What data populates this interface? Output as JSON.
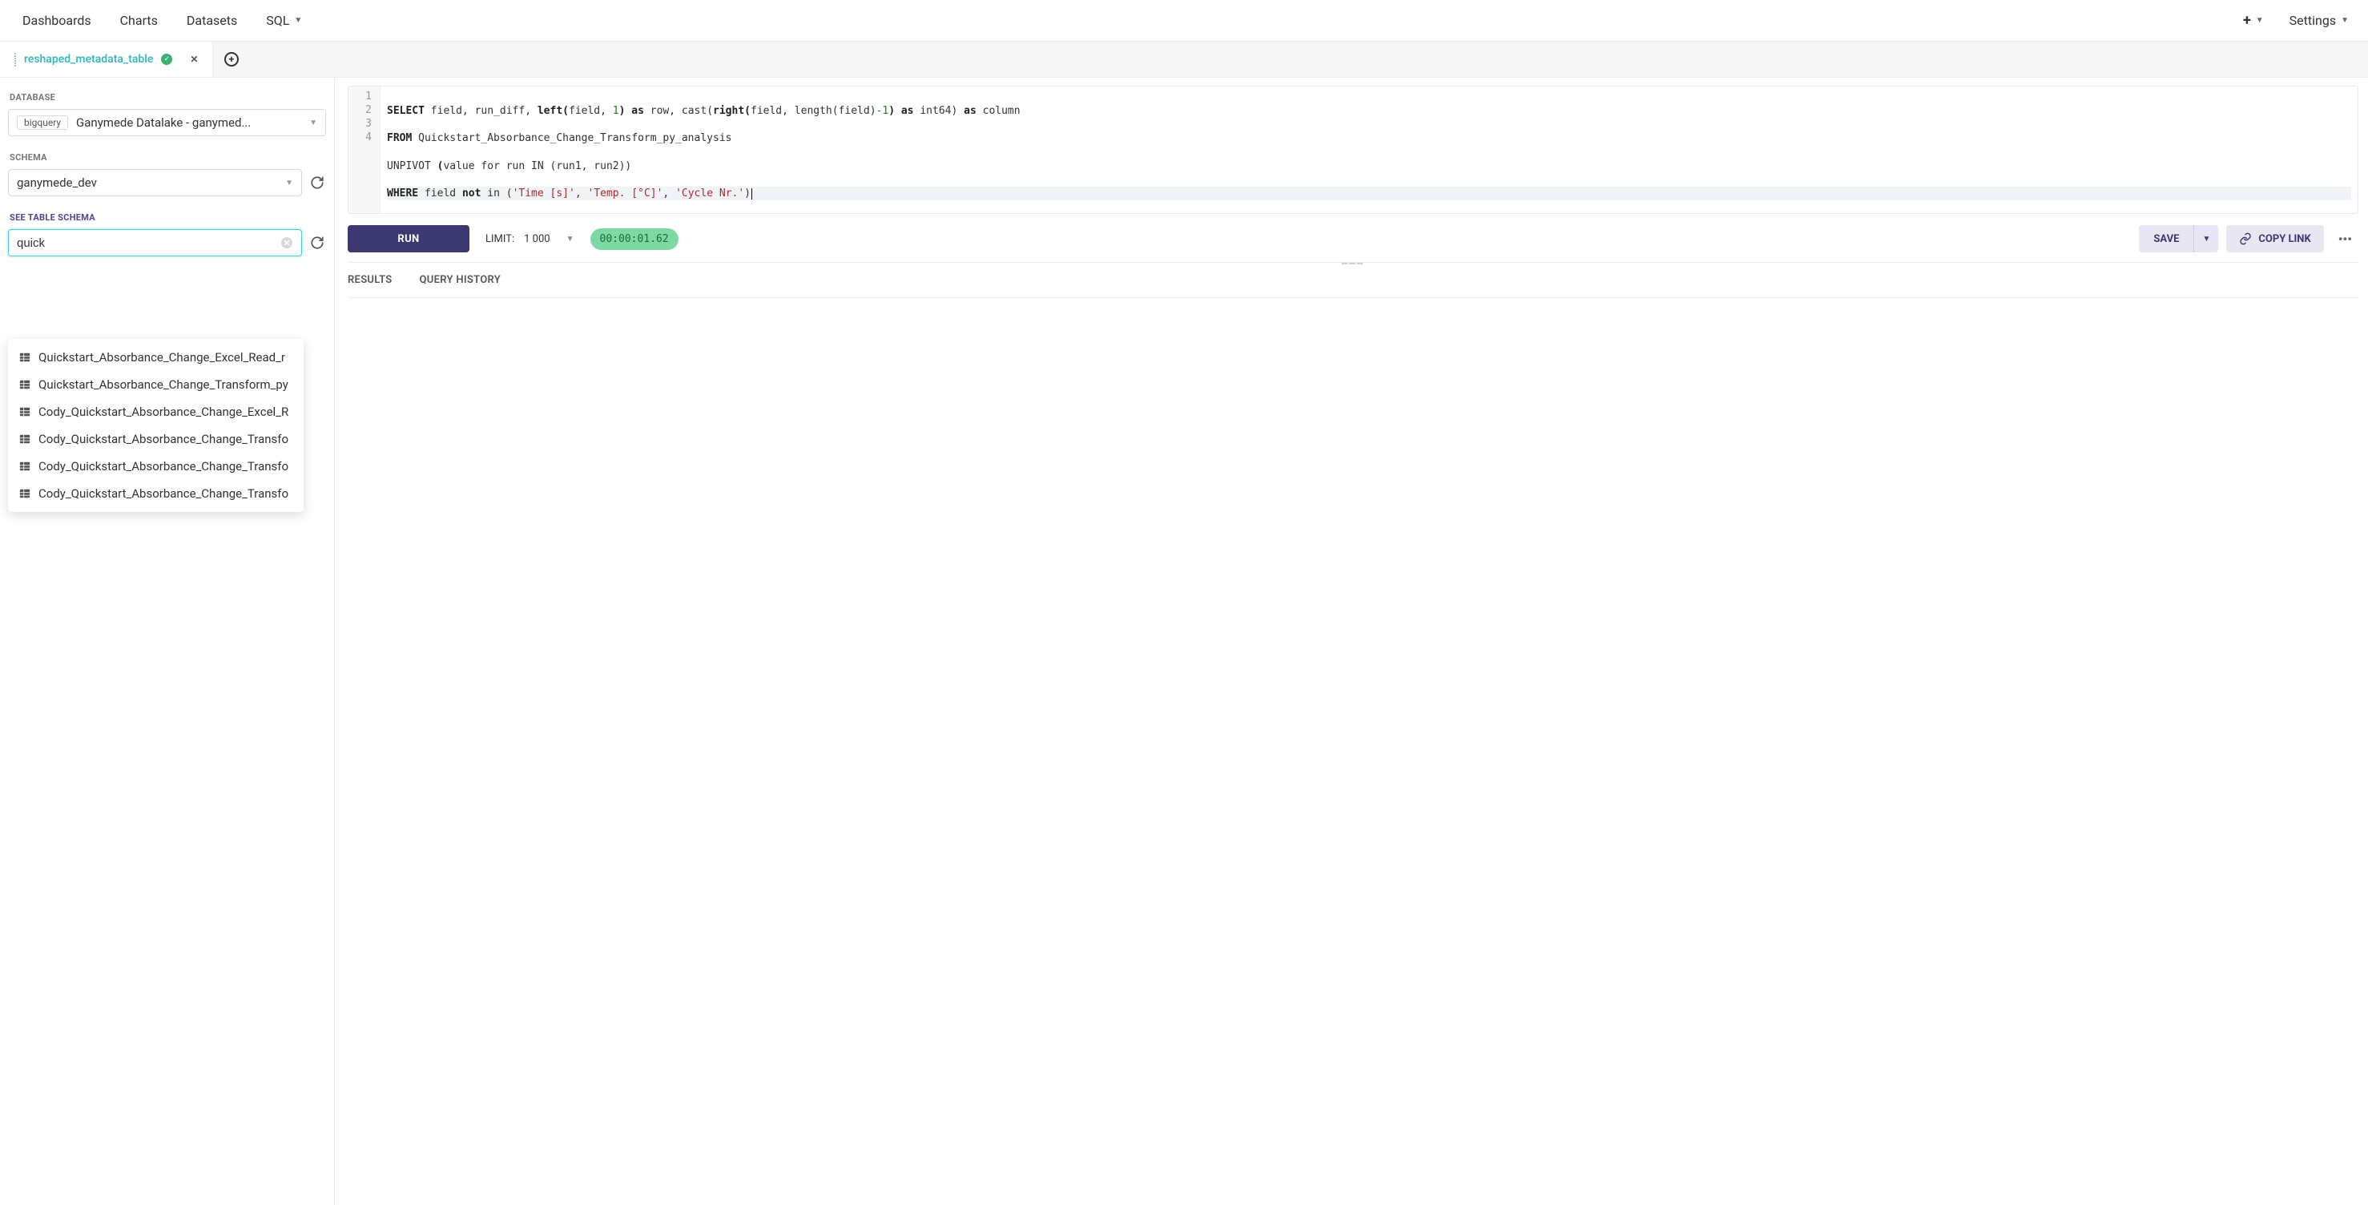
{
  "nav": {
    "items": [
      "Dashboards",
      "Charts",
      "Datasets",
      "SQL"
    ],
    "settings": "Settings"
  },
  "tab": {
    "title": "reshaped_metadata_table"
  },
  "sidebar": {
    "database_label": "DATABASE",
    "database_chip": "bigquery",
    "database_value": "Ganymede Datalake - ganymed...",
    "schema_label": "SCHEMA",
    "schema_value": "ganymede_dev",
    "see_schema_label": "SEE TABLE SCHEMA",
    "search_value": "quick",
    "table_suggestions": [
      "Quickstart_Absorbance_Change_Excel_Read_r",
      "Quickstart_Absorbance_Change_Transform_py",
      "Cody_Quickstart_Absorbance_Change_Excel_R",
      "Cody_Quickstart_Absorbance_Change_Transfo",
      "Cody_Quickstart_Absorbance_Change_Transfo",
      "Cody_Quickstart_Absorbance_Change_Transfo"
    ]
  },
  "editor": {
    "lines": [
      "1",
      "2",
      "3",
      "4"
    ],
    "code": {
      "l1_a": "SELECT",
      "l1_b": " field, run_diff, ",
      "l1_c": "left(",
      "l1_d": "field, ",
      "l1_e": "1",
      "l1_f": ")",
      "l1_g": " as",
      "l1_h": " row, cast(",
      "l1_i": "right(",
      "l1_j": "field, length(field)",
      "l1_k": "-1",
      "l1_l": ")",
      "l1_m": " as",
      "l1_n": " int64) ",
      "l1_o": "as",
      "l1_p": " column",
      "l2_a": "FROM",
      "l2_b": " Quickstart_Absorbance_Change_Transform_py_analysis",
      "l3_a": "UNPIVOT ",
      "l3_b": "(",
      "l3_c": "value for run IN (run1, run2))",
      "l4_a": "WHERE",
      "l4_b": " field ",
      "l4_c": "not",
      "l4_d": " in (",
      "l4_e": "'Time [s]'",
      "l4_f": ", ",
      "l4_g": "'Temp. [°C]'",
      "l4_h": ", ",
      "l4_i": "'Cycle Nr.'",
      "l4_j": ")"
    }
  },
  "toolbar": {
    "run": "RUN",
    "limit_label": "LIMIT:",
    "limit_value": "1 000",
    "timer": "00:00:01.62",
    "save": "SAVE",
    "copy_link": "COPY LINK"
  },
  "results": {
    "tab_results": "RESULTS",
    "tab_history": "QUERY HISTORY"
  }
}
